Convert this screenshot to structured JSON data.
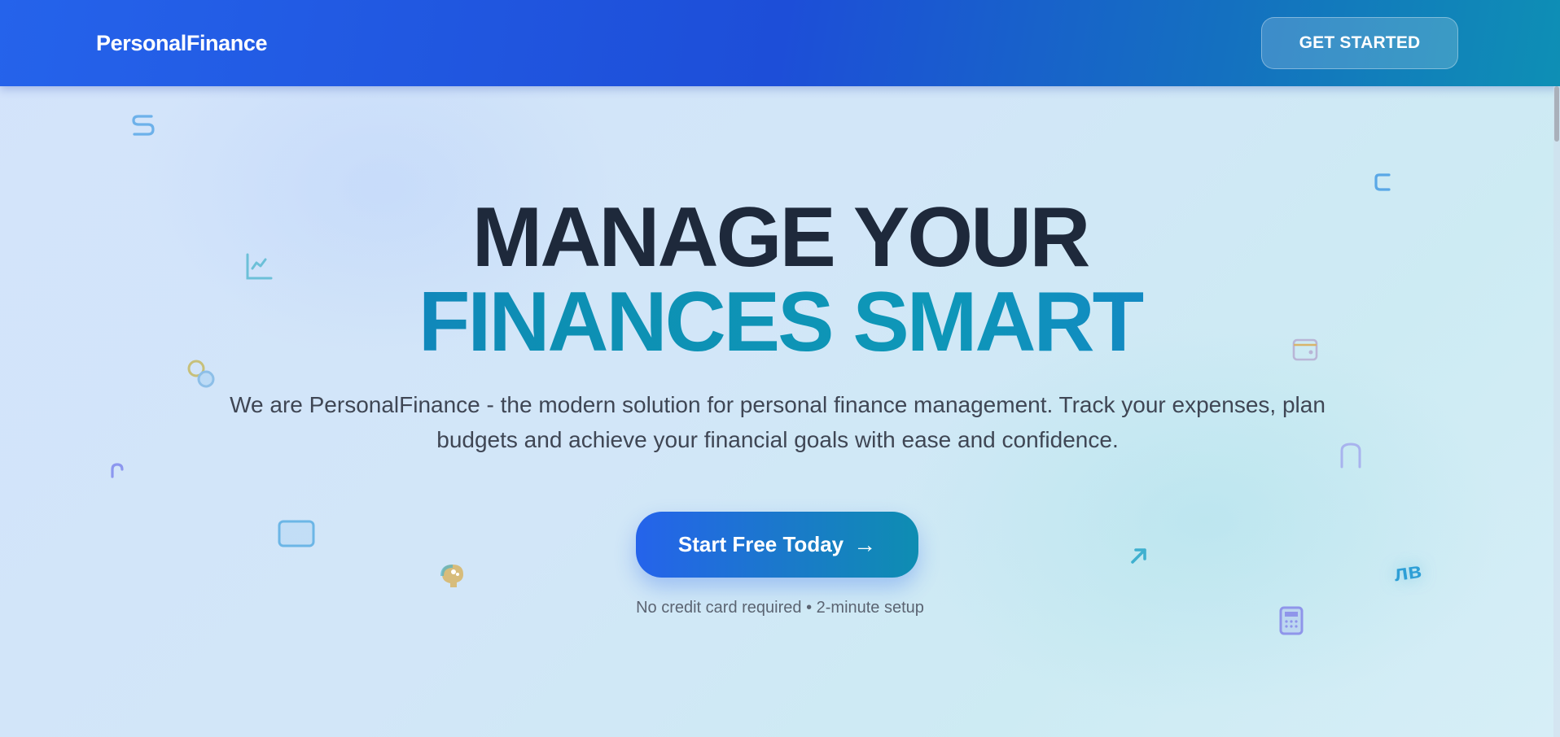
{
  "header": {
    "brand": "PersonalFinance",
    "cta_label": "GET STARTED"
  },
  "hero": {
    "title_line1": "MANAGE YOUR",
    "title_line2": "FINANCES SMART",
    "subtitle": "We are PersonalFinance - the modern solution for personal finance management. Track your expenses, plan budgets and achieve your financial goals with ease and confidence.",
    "cta_label": "Start Free Today",
    "cta_arrow": "→",
    "note": "No credit card required • 2-minute setup"
  },
  "decorations": {
    "currency_badge": "лв",
    "icons": [
      "dollar-sign-icon",
      "chart-line-icon",
      "coins-icon",
      "magnet-icon",
      "credit-card-icon",
      "piggy-bank-icon",
      "euro-sign-icon",
      "wallet-icon",
      "arch-icon",
      "arrow-up-right-icon",
      "calculator-icon"
    ]
  },
  "colors": {
    "header_gradient_start": "#2563eb",
    "header_gradient_end": "#0e8fb5",
    "title_dark": "#1e293b",
    "title_accent": "#0d8fb3",
    "cta_start": "#2563eb",
    "cta_end": "#0e8db2"
  }
}
